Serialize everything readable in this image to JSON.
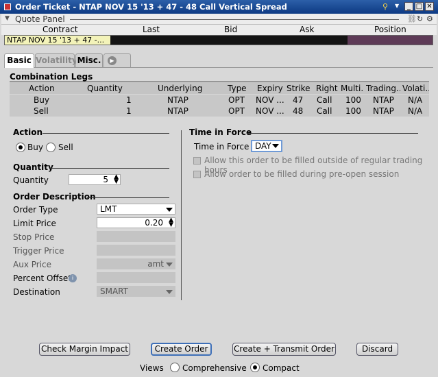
{
  "window": {
    "title": "Order Ticket - NTAP NOV 15 '13 + 47 - 48 Call Vertical Spread"
  },
  "quote_panel": {
    "title": "Quote Panel",
    "columns": [
      "Contract",
      "Last",
      "Bid",
      "Ask",
      "Position"
    ],
    "contract_value": "NTAP NOV 15 '13 + 47 -..."
  },
  "tabs": [
    {
      "label": "Basic",
      "active": true
    },
    {
      "label": "Volatility",
      "active": false
    },
    {
      "label": "Misc.",
      "active": false
    }
  ],
  "combination_legs": {
    "title": "Combination Legs",
    "columns": [
      "Action",
      "Quantity",
      "Underlying",
      "Type",
      "Expiry",
      "Strike",
      "Right",
      "Multi...",
      "Trading...",
      "Volati..."
    ],
    "rows": [
      [
        "Buy",
        "1",
        "NTAP",
        "OPT",
        "NOV ...",
        "47",
        "Call",
        "100",
        "NTAP",
        "N/A"
      ],
      [
        "Sell",
        "1",
        "NTAP",
        "OPT",
        "NOV ...",
        "48",
        "Call",
        "100",
        "NTAP",
        "N/A"
      ]
    ]
  },
  "action": {
    "title": "Action",
    "buy_label": "Buy",
    "sell_label": "Sell",
    "selected": "Buy"
  },
  "quantity": {
    "title": "Quantity",
    "label": "Quantity",
    "value": "5"
  },
  "order_description": {
    "title": "Order Description",
    "order_type_label": "Order Type",
    "order_type_value": "LMT",
    "limit_price_label": "Limit Price",
    "limit_price_value": "0.20",
    "stop_price_label": "Stop Price",
    "trigger_price_label": "Trigger Price",
    "aux_price_label": "Aux Price",
    "aux_price_value": "amt",
    "percent_offset_label": "Percent Offset",
    "destination_label": "Destination",
    "destination_value": "SMART"
  },
  "time_in_force": {
    "title": "Time in Force",
    "label": "Time in Force",
    "value": "DAY",
    "option_outside_hours": "Allow this order to be filled outside of regular trading hours",
    "option_pre_open": "Allow order to be filled during pre-open session"
  },
  "buttons": {
    "check_margin": "Check Margin Impact",
    "create_order": "Create Order",
    "create_transmit": "Create + Transmit Order",
    "discard": "Discard"
  },
  "views": {
    "label": "Views",
    "comprehensive": "Comprehensive",
    "compact": "Compact",
    "selected": "Compact"
  }
}
